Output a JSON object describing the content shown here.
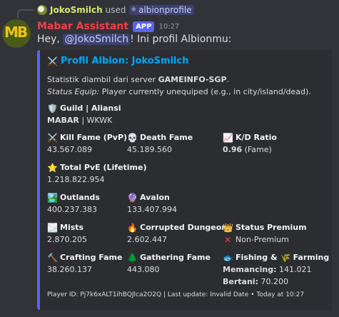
{
  "reply": {
    "user": "JokoSmilch",
    "used_text": "used",
    "command": "albionprofile"
  },
  "message": {
    "bot_name": "Mabar Assistant",
    "app_tag": "APP",
    "time": "10:27",
    "greeting_prefix": "Hey, ",
    "mention": "@JokoSmilch",
    "greeting_suffix": "! Ini profil Albionmu:"
  },
  "embed": {
    "accent_color": "#5865f2",
    "title": "Profil Albion: JokoSmilch",
    "desc_line1_prefix": "Statistik diambil dari server ",
    "desc_line1_bold": "GAMEINFO-SGP",
    "desc_line1_suffix": ".",
    "desc_line2_italic": "Status Equip:",
    "desc_line2_text": " Player currently unequiped (e.g., in city/island/dead).",
    "guild": {
      "name": "Guild | Aliansi",
      "value_bold": "MABAR",
      "value_rest": " | WKWK"
    },
    "kill_fame": {
      "name": "Kill Fame (PvP)",
      "value": "43.567.089"
    },
    "death_fame": {
      "name": "Death Fame",
      "value": "45.189.560"
    },
    "kd_ratio": {
      "name": "K/D Ratio",
      "value_bold": "0.96",
      "value_rest": " (Fame)"
    },
    "total_pve": {
      "name": "Total PvE (Lifetime)",
      "value": "1.218.822.954"
    },
    "outlands": {
      "name": "Outlands",
      "value": "400.237.383"
    },
    "avalon": {
      "name": "Avalon",
      "value": "133.407.994"
    },
    "mists": {
      "name": "Mists",
      "value": "2.870.205"
    },
    "corrupted": {
      "name": "Corrupted Dungeon",
      "value": "2.602.447"
    },
    "premium": {
      "name": "Status Premium",
      "value": "Non-Premium"
    },
    "crafting": {
      "name": "Crafting Fame",
      "value": "38.260.137"
    },
    "gathering": {
      "name": "Gathering Fame",
      "value": "443.080"
    },
    "fishing": {
      "name_part1": "Fishing &",
      "name_part2": "Farming",
      "fishing_label": "Memancing:",
      "fishing_value": " 141.021",
      "farming_label": "Bertani:",
      "farming_value": " 70.200"
    },
    "footer": "Player ID: Pj7k6xALT1ihBQJlca2O2Q | Last update: Invalid Date • Today at 10:27"
  }
}
